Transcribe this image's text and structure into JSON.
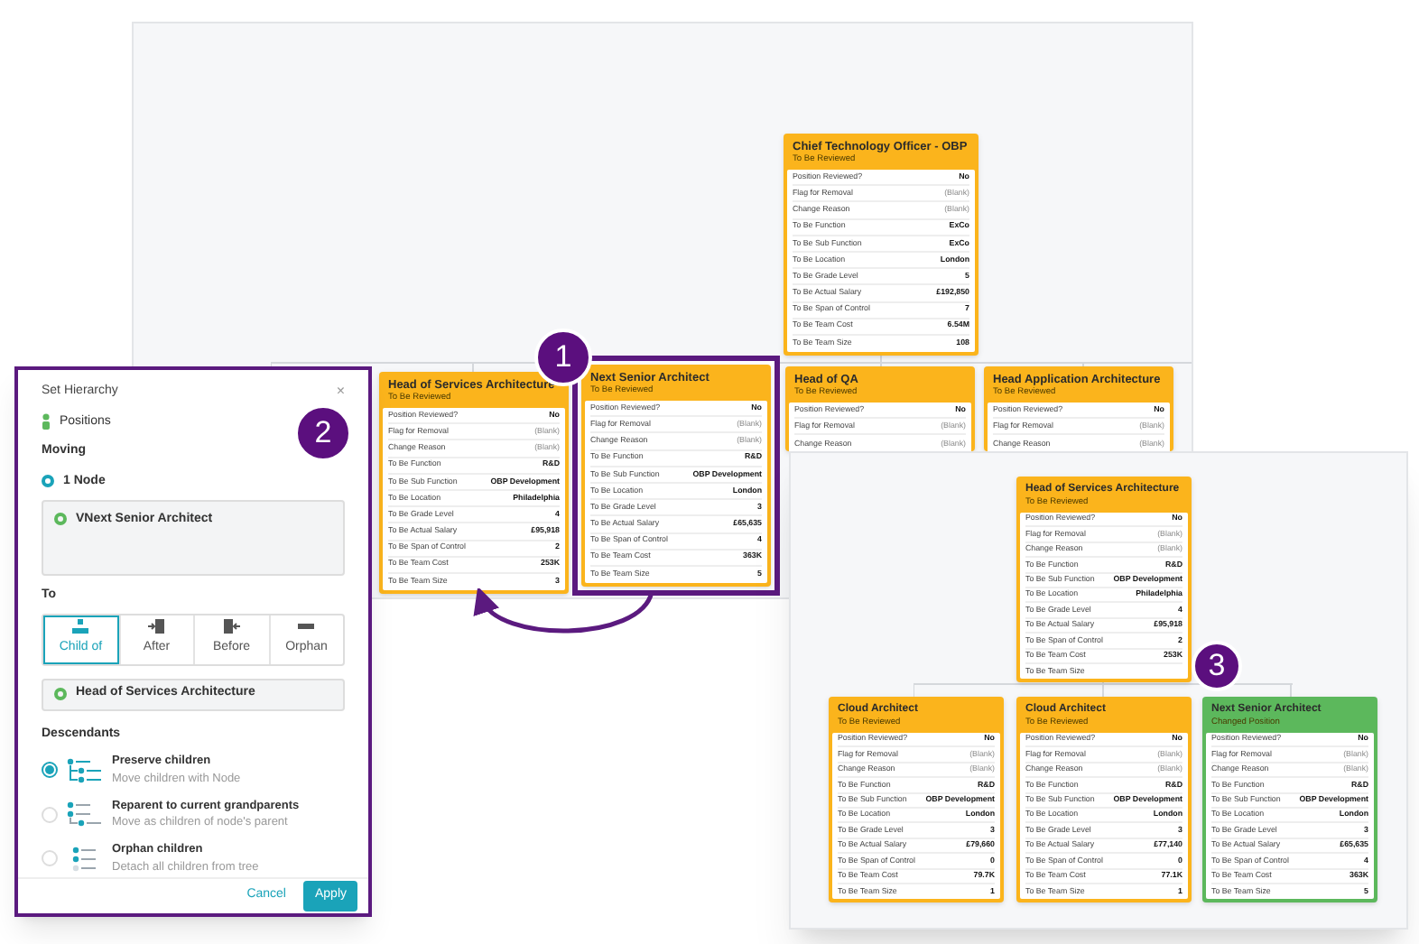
{
  "chart": {
    "cards": [
      {
        "title": "Chief Technology Officer - OBP",
        "status": "To Be Reviewed",
        "kind": "reviewed",
        "highlighted": false,
        "rows": [
          {
            "label": "Position Reviewed?",
            "value": "No"
          },
          {
            "label": "Flag for Removal",
            "placeholder": "(Blank)"
          },
          {
            "label": "Change Reason",
            "placeholder": "(Blank)"
          },
          {
            "label": "To Be Function",
            "value": "ExCo"
          },
          {
            "label": "To Be Sub Function",
            "value": "ExCo"
          },
          {
            "label": "To Be Location",
            "value": "London"
          },
          {
            "label": "To Be Grade Level",
            "value": "5"
          },
          {
            "label": "To Be Actual Salary",
            "value": "£192,850"
          },
          {
            "label": "To Be Span of Control",
            "value": "7"
          },
          {
            "label": "To Be Team Cost",
            "value": "6.54M"
          },
          {
            "label": "To Be Team Size",
            "value": "108"
          }
        ]
      },
      {
        "title": "Head of Services Architecture",
        "status": "To Be Reviewed",
        "kind": "reviewed",
        "highlighted": false,
        "rows": [
          {
            "label": "Position Reviewed?",
            "value": "No"
          },
          {
            "label": "Flag for Removal",
            "placeholder": "(Blank)"
          },
          {
            "label": "Change Reason",
            "placeholder": "(Blank)"
          },
          {
            "label": "To Be Function",
            "value": "R&D"
          },
          {
            "label": "To Be Sub Function",
            "value": "OBP Development"
          },
          {
            "label": "To Be Location",
            "value": "Philadelphia"
          },
          {
            "label": "To Be Grade Level",
            "value": "4"
          },
          {
            "label": "To Be Actual Salary",
            "value": "£95,918"
          },
          {
            "label": "To Be Span of Control",
            "value": "2"
          },
          {
            "label": "To Be Team Cost",
            "value": "253K"
          },
          {
            "label": "To Be Team Size",
            "value": "3"
          }
        ]
      },
      {
        "title": "Next Senior Architect",
        "status": "To Be Reviewed",
        "kind": "reviewed",
        "highlighted": true,
        "rows": [
          {
            "label": "Position Reviewed?",
            "value": "No"
          },
          {
            "label": "Flag for Removal",
            "placeholder": "(Blank)"
          },
          {
            "label": "Change Reason",
            "placeholder": "(Blank)"
          },
          {
            "label": "To Be Function",
            "value": "R&D"
          },
          {
            "label": "To Be Sub Function",
            "value": "OBP Development"
          },
          {
            "label": "To Be Location",
            "value": "London"
          },
          {
            "label": "To Be Grade Level",
            "value": "3"
          },
          {
            "label": "To Be Actual Salary",
            "value": "£65,635"
          },
          {
            "label": "To Be Span of Control",
            "value": "4"
          },
          {
            "label": "To Be Team Cost",
            "value": "363K"
          },
          {
            "label": "To Be Team Size",
            "value": "5"
          }
        ]
      },
      {
        "title": "Head of QA",
        "status": "To Be Reviewed",
        "kind": "reviewed",
        "highlighted": false,
        "rows": [
          {
            "label": "Position Reviewed?",
            "value": "No"
          },
          {
            "label": "Flag for Removal",
            "placeholder": "(Blank)"
          },
          {
            "label": "Change Reason",
            "placeholder": "(Blank)"
          }
        ]
      },
      {
        "title": "Head Application Architecture",
        "status": "To Be Reviewed",
        "kind": "reviewed",
        "highlighted": false,
        "rows": [
          {
            "label": "Position Reviewed?",
            "value": "No"
          },
          {
            "label": "Flag for Removal",
            "placeholder": "(Blank)"
          },
          {
            "label": "Change Reason",
            "placeholder": "(Blank)"
          }
        ]
      }
    ]
  },
  "result": {
    "cards": [
      {
        "title": "Head of Services Architecture",
        "status": "To Be Reviewed",
        "kind": "reviewed",
        "highlighted": false,
        "rows": [
          {
            "label": "Position Reviewed?",
            "value": "No"
          },
          {
            "label": "Flag for Removal",
            "placeholder": "(Blank)"
          },
          {
            "label": "Change Reason",
            "placeholder": "(Blank)"
          },
          {
            "label": "To Be Function",
            "value": "R&D"
          },
          {
            "label": "To Be Sub Function",
            "value": "OBP Development"
          },
          {
            "label": "To Be Location",
            "value": "Philadelphia"
          },
          {
            "label": "To Be Grade Level",
            "value": "4"
          },
          {
            "label": "To Be Actual Salary",
            "value": "£95,918"
          },
          {
            "label": "To Be Span of Control",
            "value": "2"
          },
          {
            "label": "To Be Team Cost",
            "value": "253K"
          },
          {
            "label": "To Be Team Size"
          }
        ]
      },
      {
        "title": "Cloud Architect",
        "status": "To Be Reviewed",
        "kind": "reviewed",
        "highlighted": false,
        "rows": [
          {
            "label": "Position Reviewed?",
            "value": "No"
          },
          {
            "label": "Flag for Removal",
            "placeholder": "(Blank)"
          },
          {
            "label": "Change Reason",
            "placeholder": "(Blank)"
          },
          {
            "label": "To Be Function",
            "value": "R&D"
          },
          {
            "label": "To Be Sub Function",
            "value": "OBP Development"
          },
          {
            "label": "To Be Location",
            "value": "London"
          },
          {
            "label": "To Be Grade Level",
            "value": "3"
          },
          {
            "label": "To Be Actual Salary",
            "value": "£79,660"
          },
          {
            "label": "To Be Span of Control",
            "value": "0"
          },
          {
            "label": "To Be Team Cost",
            "value": "79.7K"
          },
          {
            "label": "To Be Team Size",
            "value": "1"
          }
        ]
      },
      {
        "title": "Cloud Architect",
        "status": "To Be Reviewed",
        "kind": "reviewed",
        "highlighted": false,
        "rows": [
          {
            "label": "Position Reviewed?",
            "value": "No"
          },
          {
            "label": "Flag for Removal",
            "placeholder": "(Blank)"
          },
          {
            "label": "Change Reason",
            "placeholder": "(Blank)"
          },
          {
            "label": "To Be Function",
            "value": "R&D"
          },
          {
            "label": "To Be Sub Function",
            "value": "OBP Development"
          },
          {
            "label": "To Be Location",
            "value": "London"
          },
          {
            "label": "To Be Grade Level",
            "value": "3"
          },
          {
            "label": "To Be Actual Salary",
            "value": "£77,140"
          },
          {
            "label": "To Be Span of Control",
            "value": "0"
          },
          {
            "label": "To Be Team Cost",
            "value": "77.1K"
          },
          {
            "label": "To Be Team Size",
            "value": "1"
          }
        ]
      },
      {
        "title": "Next Senior Architect",
        "status": "Changed Position",
        "kind": "changed",
        "highlighted": false,
        "rows": [
          {
            "label": "Position Reviewed?",
            "value": "No"
          },
          {
            "label": "Flag for Removal",
            "placeholder": "(Blank)"
          },
          {
            "label": "Change Reason",
            "placeholder": "(Blank)"
          },
          {
            "label": "To Be Function",
            "value": "R&D"
          },
          {
            "label": "To Be Sub Function",
            "value": "OBP Development"
          },
          {
            "label": "To Be Location",
            "value": "London"
          },
          {
            "label": "To Be Grade Level",
            "value": "3"
          },
          {
            "label": "To Be Actual Salary",
            "value": "£65,635"
          },
          {
            "label": "To Be Span of Control",
            "value": "4"
          },
          {
            "label": "To Be Team Cost",
            "value": "363K"
          },
          {
            "label": "To Be Team Size",
            "value": "5"
          }
        ]
      }
    ]
  },
  "panel": {
    "title": "Set Hierarchy",
    "close": "×",
    "scope": "Positions",
    "moving_heading": "Moving",
    "moving_count": "1 Node",
    "moving_node": "VNext Senior Architect",
    "to_heading": "To",
    "to_options": [
      {
        "label": "Child of",
        "kind": "child",
        "selected": true
      },
      {
        "label": "After",
        "kind": "after",
        "selected": false
      },
      {
        "label": "Before",
        "kind": "before",
        "selected": false
      },
      {
        "label": "Orphan",
        "kind": "orphan",
        "selected": false
      }
    ],
    "target": "Head of Services Architecture",
    "descendants_heading": "Descendants",
    "descendants": [
      {
        "title": "Preserve children",
        "subtitle": "Move children with Node",
        "kind": "preserve",
        "selected": true
      },
      {
        "title": "Reparent to current grandparents",
        "subtitle": "Move as children of node's parent",
        "kind": "reparent",
        "selected": false
      },
      {
        "title": "Orphan children",
        "subtitle": "Detach all children from tree",
        "kind": "orphan",
        "selected": false
      }
    ],
    "buttons": {
      "cancel": "Cancel",
      "apply": "Apply"
    }
  },
  "callouts": [
    "1",
    "2",
    "3"
  ]
}
